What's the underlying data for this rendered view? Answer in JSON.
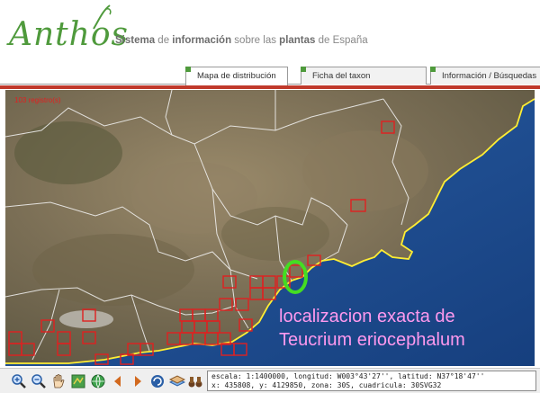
{
  "header": {
    "logo": "Anthos",
    "tagline": {
      "p1": "Sistema",
      "p2": " de ",
      "p3": "información",
      "p4": " sobre las ",
      "p5": "plantas",
      "p6": " de España"
    }
  },
  "tabs": [
    {
      "label": "Mapa de distribución",
      "active": true
    },
    {
      "label": "Ficha del taxon",
      "active": false
    },
    {
      "label": "Información / Búsquedas",
      "active": false
    }
  ],
  "map": {
    "record_count": "103 registro(s)",
    "annotation_line1": "localizacion exacta de",
    "annotation_line2": "Teucrium eriocephalum",
    "colors": {
      "grid_square": "#e02020",
      "coastline": "#ffee33",
      "highlight_circle": "#44dd22",
      "annotation_text": "#ff99ee"
    }
  },
  "toolbar": {
    "tools": [
      "zoom-in-icon",
      "zoom-out-icon",
      "pan-hand-icon",
      "map-layer-icon",
      "globe-icon",
      "layers-icon",
      "back-arrow-icon",
      "forward-arrow-icon",
      "refresh-icon",
      "info-icon",
      "print-icon",
      "binoculars-icon"
    ]
  },
  "status": {
    "line1": "escala: 1:1400000, longitud: W003°43'27'', latitud: N37°18'47''",
    "line2": "x: 435808, y: 4129850, zona: 30S, cuadricula: 30SVG32"
  }
}
